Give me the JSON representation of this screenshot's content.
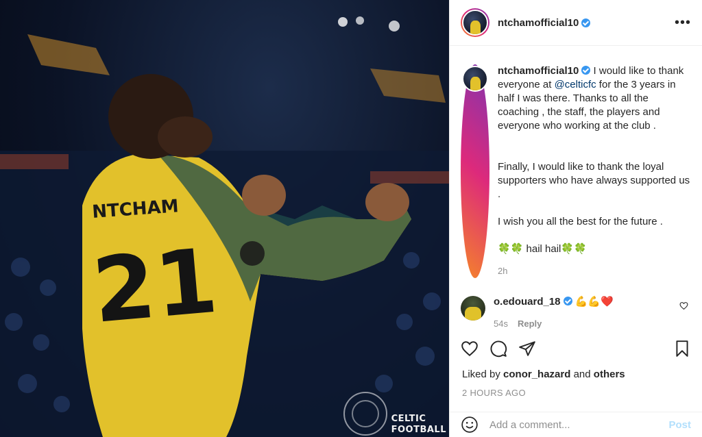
{
  "post": {
    "username": "ntchamofficial10",
    "verified": true,
    "more_icon": "more-horizontal-icon",
    "image": {
      "jersey_name": "NTCHAM",
      "jersey_number": "21",
      "watermark_line1": "CELTIC",
      "watermark_line2": "FOOTBALL"
    },
    "caption": {
      "username": "ntchamofficial10",
      "text_before_mention": "I would like to thank everyone at ",
      "mention": "@celticfc",
      "text_after_mention": " for the 3 years in half I was there. Thanks to all the coaching , the staff, the players and everyone who working at the club .",
      "paragraph2": "Finally, I would like to thank the loyal supporters who have always supported us .",
      "paragraph3": "I wish you all the best for the future .",
      "paragraph4": "🍀🍀 hail hail🍀🍀",
      "time": "2h"
    },
    "comments": [
      {
        "username": "o.edouard_18",
        "verified": true,
        "text": "💪💪❤️",
        "time": "54s",
        "reply_label": "Reply"
      }
    ],
    "likes": {
      "prefix": "Liked by ",
      "user": "conor_hazard",
      "middle": " and ",
      "others": "others"
    },
    "timestamp": "2 HOURS AGO",
    "add_comment": {
      "placeholder": "Add a comment...",
      "post_label": "Post"
    }
  },
  "colors": {
    "verified_blue": "#3897f0",
    "mention": "#00376b",
    "post_button_disabled": "#b2dffc",
    "secondary_text": "#8e8e8e",
    "jersey_yellow": "#e2c12b"
  }
}
